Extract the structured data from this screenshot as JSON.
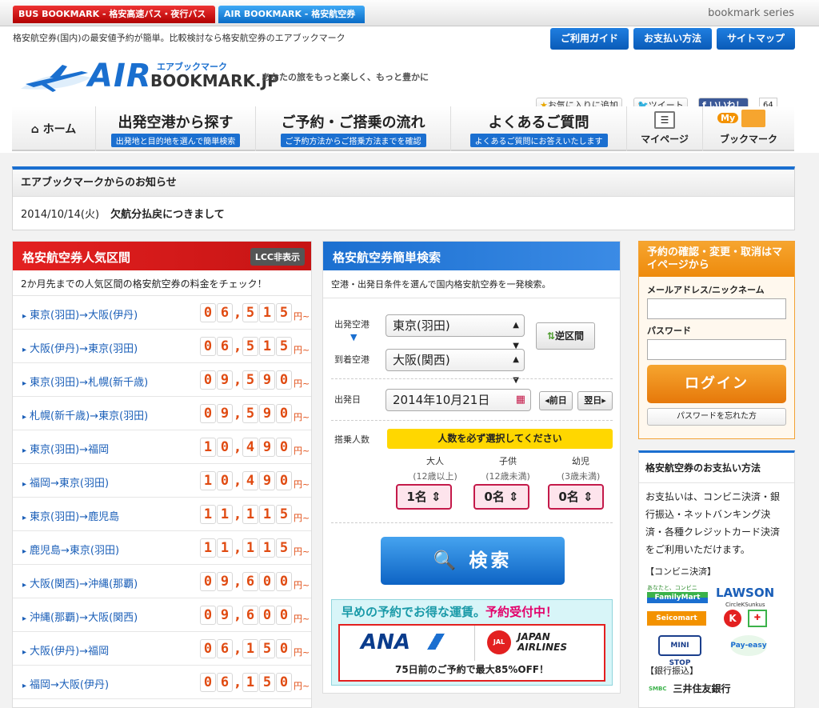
{
  "topbar": {
    "bus_tab": "BUS BOOKMARK - 格安高速バス・夜行バス -",
    "air_tab": "AIR BOOKMARK - 格安航空券 -",
    "series": "bookmark series"
  },
  "header": {
    "tagline": "格安航空券(国内)の最安値予約が簡単。比較検討なら格安航空券のエアブックマーク",
    "guide": "ご利用ガイド",
    "payment": "お支払い方法",
    "sitemap": "サイトマップ",
    "logo_air": "AIR",
    "logo_small": "エアブックマーク",
    "logo_bm": "BOOKMARK.JP",
    "slogan": "あなたの旅をもっと楽しく、もっと豊かに",
    "fav": "お気に入りに追加",
    "tweet": "ツイート",
    "like": "いいね！",
    "like_count": "64"
  },
  "nav": {
    "home": "ホーム",
    "depart_title": "出発空港から探す",
    "depart_sub": "出発地と目的地を選んで簡単検索",
    "flow_title": "ご予約・ご搭乗の流れ",
    "flow_sub": "ご予約方法からご搭乗方法までを確認",
    "faq_title": "よくあるご質問",
    "faq_sub": "よくあるご質問にお答えいたします",
    "mypage": "マイページ",
    "my_badge": "My",
    "bookmark": "ブックマーク"
  },
  "notice": {
    "title": "エアブックマークからのお知らせ",
    "date": "2014/10/14(火)",
    "text": "欠航分払戻につきまして"
  },
  "popular": {
    "title": "格安航空券人気区間",
    "lcc": "LCC非表示",
    "desc": "2か月先までの人気区間の格安航空券の料金をチェック！",
    "yen": "円~",
    "routes": [
      {
        "name": "東京(羽田)→大阪(伊丹)",
        "price": "06,515"
      },
      {
        "name": "大阪(伊丹)→東京(羽田)",
        "price": "06,515"
      },
      {
        "name": "東京(羽田)→札幌(新千歳)",
        "price": "09,590"
      },
      {
        "name": "札幌(新千歳)→東京(羽田)",
        "price": "09,590"
      },
      {
        "name": "東京(羽田)→福岡",
        "price": "10,490"
      },
      {
        "name": "福岡→東京(羽田)",
        "price": "10,490"
      },
      {
        "name": "東京(羽田)→鹿児島",
        "price": "11,115"
      },
      {
        "name": "鹿児島→東京(羽田)",
        "price": "11,115"
      },
      {
        "name": "大阪(関西)→沖縄(那覇)",
        "price": "09,600"
      },
      {
        "name": "沖縄(那覇)→大阪(関西)",
        "price": "09,600"
      },
      {
        "name": "大阪(伊丹)→福岡",
        "price": "06,150"
      },
      {
        "name": "福岡→大阪(伊丹)",
        "price": "06,150"
      }
    ]
  },
  "search": {
    "title": "格安航空券簡単検索",
    "desc": "空港・出発日条件を選んで国内格安航空券を一発検索。",
    "dep_label": "出発空港",
    "dep": "東京(羽田)",
    "arr_label": "到着空港",
    "arr": "大阪(関西)",
    "swap": "逆区間",
    "date_label": "出発日",
    "date": "2014年10月21日",
    "prev": "◂前日",
    "next": "翌日▸",
    "pax_label": "搭乗人数",
    "pax_notice": "人数を必ず選択してください",
    "adult": "大人",
    "adult_sub": "(12歳以上)",
    "child": "子供",
    "child_sub": "(12歳未満)",
    "infant": "幼児",
    "infant_sub": "(3歳未満)",
    "adult_val": "1名",
    "child_val": "0名",
    "infant_val": "0名",
    "button": "検索"
  },
  "promo": {
    "headline": "早めの予約でお得な運賃。",
    "headline2": "予約受付中！",
    "ana": "ANA",
    "jal1": "JAPAN",
    "jal2": "AIRLINES",
    "jal_small": "JAL",
    "footer": "75日前のご予約で最大85%OFF！"
  },
  "login": {
    "title": "予約の確認・変更・取消はマイページから",
    "email_label": "メールアドレス/ニックネーム",
    "pw_label": "パスワード",
    "button": "ログイン",
    "forgot": "パスワードを忘れた方"
  },
  "pay": {
    "title": "格安航空券のお支払い方法",
    "desc": "お支払いは、コンビニ決済・銀行振込・ネットバンキング決済・各種クレジットカード決済をご利用いただけます。",
    "conv": "【コンビニ決済】",
    "familymart": "FamilyMart",
    "familymart_tag": "あなたと、コンビニに、",
    "lawson": "LAWSON",
    "circlek": "CircleKSunkus",
    "seicomart": "Seicomart",
    "ministop": "MINI STOP",
    "payeasy": "Pay-easy",
    "bank": "【銀行振込】",
    "smbc": "三井住友銀行",
    "smbc_logo": "SMBC"
  },
  "colors": {
    "red": "#e32020",
    "blue": "#1b6fd0",
    "orange": "#f39200",
    "price": "#e04b12"
  }
}
